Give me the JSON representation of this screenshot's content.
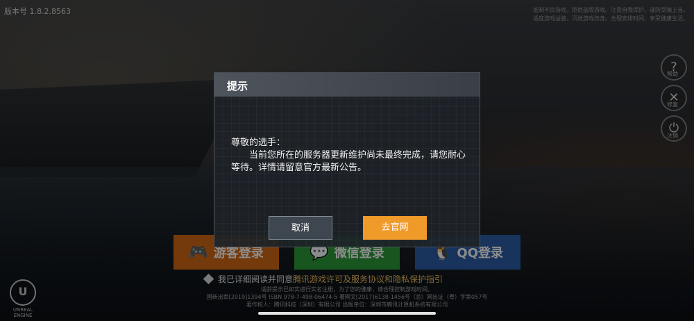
{
  "version": "版本号 1.8.2.8563",
  "notice": [
    "抵制不良游戏，拒绝盗版游戏。注意自我保护，谨防受骗上当。",
    "适度游戏益脑，沉迷游戏伤身。合理安排时间，享受健康生活。"
  ],
  "side_buttons": [
    {
      "icon": "?",
      "label": "帮助"
    },
    {
      "icon": "✕",
      "label": "修复"
    },
    {
      "icon": "⏻",
      "label": "注销"
    }
  ],
  "login": {
    "guest": "游客登录",
    "wechat": "微信登录",
    "qq": "QQ登录"
  },
  "agreement": {
    "prefix": "我已详细阅读并同意",
    "link": "腾讯游戏许可及服务协议和隐私保护指引"
  },
  "legal": [
    "适龄提示已如实进行实名注册，为了您的健康，请合理控制游戏时间。",
    "国新出审[2019]1394号  ISBN 978-7-498-06474-5  著网文[2017]6138-1456号（总）网出证（粤）字第057号",
    "著作权人：腾讯科技（深圳）有限公司  出版单位：深圳市腾讯计算机系统有限公司"
  ],
  "engine": "UNREAL ENGINE",
  "dialog": {
    "title": "提示",
    "greeting": "尊敬的选手：",
    "message": "当前您所在的服务器更新维护尚未最终完成，请您耐心等待。详情请留意官方最新公告。",
    "cancel": "取消",
    "confirm": "去官网"
  }
}
